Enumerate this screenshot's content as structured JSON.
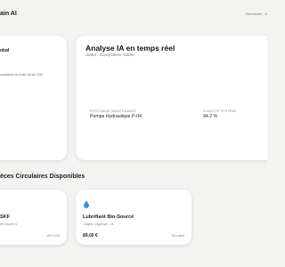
{
  "header": {
    "brand": "ain AI",
    "user_label": "Technicien : A"
  },
  "left_card": {
    "title": "obal",
    "text": "onsations un évité 12t de CO2"
  },
  "ai_card": {
    "title": "Analyse IA en temps réel",
    "status": "Statut : Écosystème stable",
    "metrics": [
      {
        "label": "PROCHAINE MAINTENANCE",
        "value": "Pompe Hydraulique P-04"
      },
      {
        "label": "FIABILITÉ SYSTÈME",
        "value": "94.2 %"
      }
    ]
  },
  "parts_section": {
    "title": "èces Circulaires Disponibles",
    "parts": [
      {
        "name": "SKF",
        "origin": "ité Grade A",
        "price": "",
        "tag": "-15% CO2"
      },
      {
        "name": "Lubrifiant Bio-Sourcé",
        "origin": "Origine végétale - 1L",
        "price": "89,00 €",
        "tag": "Éco-label",
        "icon": "droplet-icon"
      }
    ]
  },
  "colors": {
    "background": "#f3f4f2",
    "card": "#ffffff",
    "droplet": "#3b8fd6"
  }
}
